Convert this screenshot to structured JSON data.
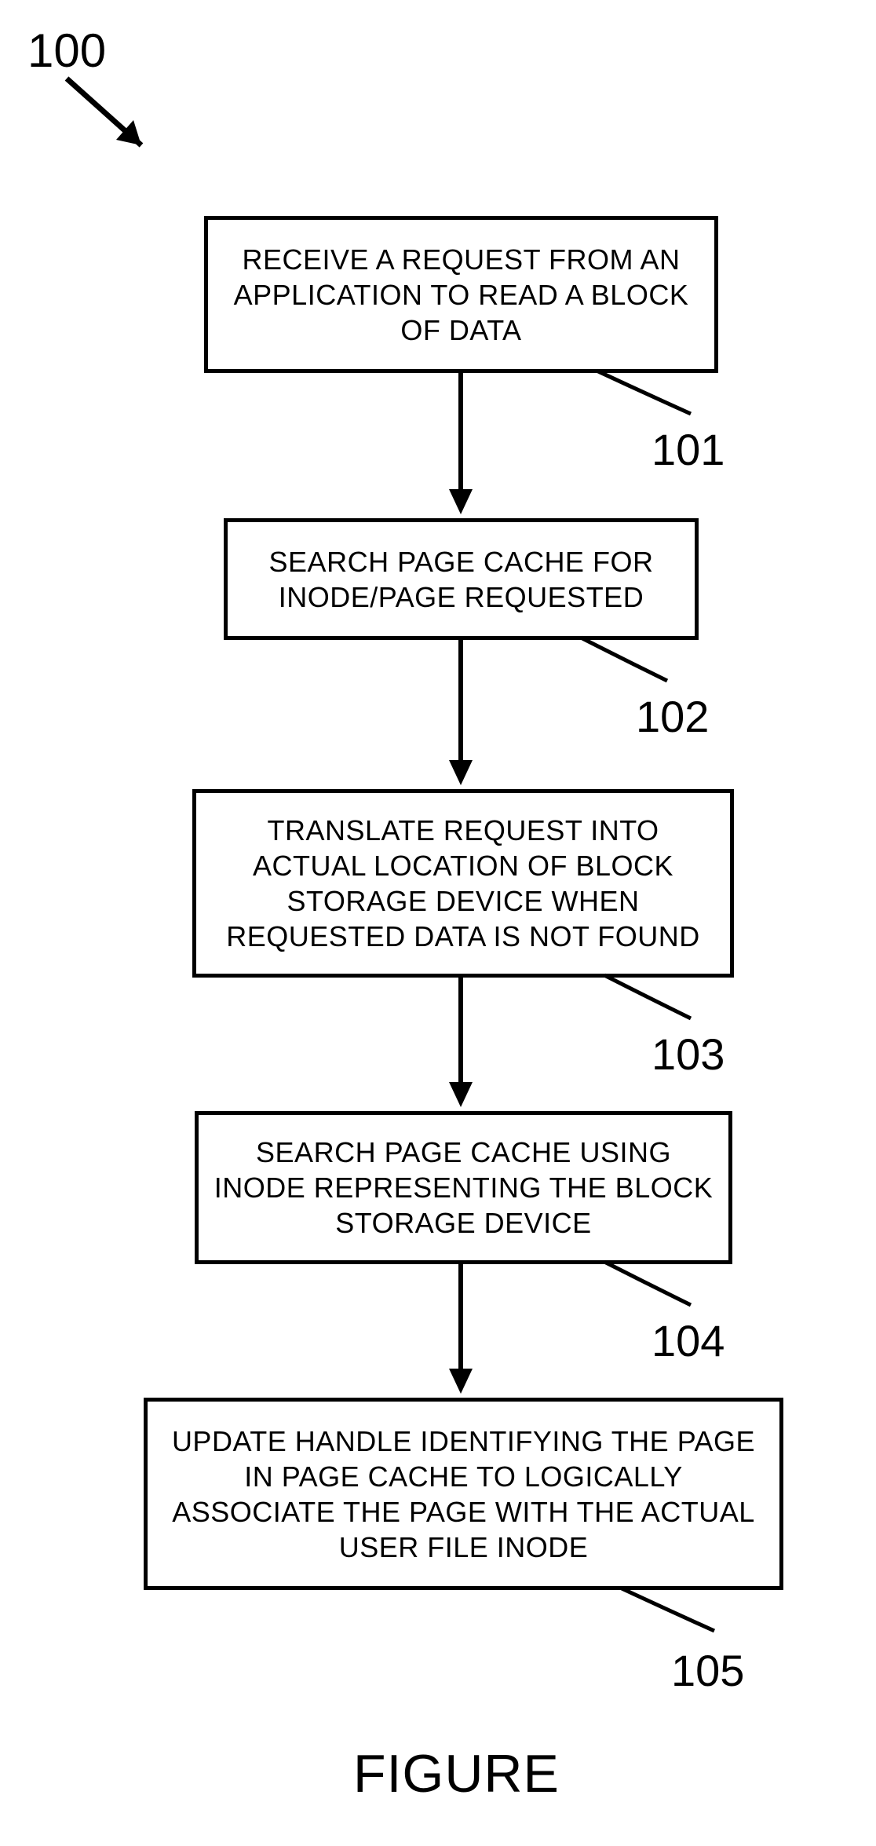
{
  "diagram": {
    "reference_number": "100",
    "figure_label": "FIGURE",
    "steps": [
      {
        "id": "101",
        "text": "RECEIVE A REQUEST FROM AN APPLICATION TO READ A BLOCK OF DATA"
      },
      {
        "id": "102",
        "text": "SEARCH PAGE CACHE FOR INODE/PAGE REQUESTED"
      },
      {
        "id": "103",
        "text": "TRANSLATE REQUEST INTO ACTUAL LOCATION OF BLOCK STORAGE DEVICE WHEN REQUESTED DATA IS NOT FOUND"
      },
      {
        "id": "104",
        "text": "SEARCH PAGE CACHE USING INODE REPRESENTING THE BLOCK STORAGE DEVICE"
      },
      {
        "id": "105",
        "text": "UPDATE HANDLE IDENTIFYING THE PAGE IN PAGE CACHE TO LOGICALLY ASSOCIATE THE PAGE WITH THE ACTUAL USER FILE INODE"
      }
    ]
  }
}
